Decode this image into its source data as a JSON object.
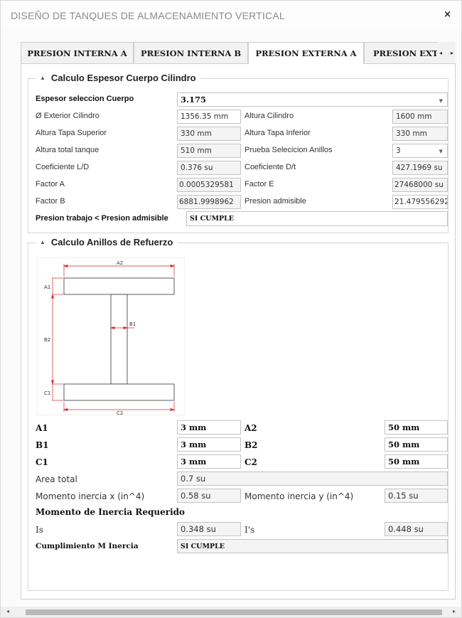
{
  "window": {
    "title": "DISEÑO DE TANQUES DE ALMACENAMIENTO VERTICAL",
    "close_glyph": "×"
  },
  "tabs": [
    {
      "label": "PRESION INTERNA A",
      "active": false
    },
    {
      "label": "PRESION INTERNA B",
      "active": false
    },
    {
      "label": "PRESION EXTERNA A",
      "active": true
    },
    {
      "label": "PRESION EXTERNA B",
      "active": false
    }
  ],
  "tab_nav": {
    "left": "◂",
    "right": "▸"
  },
  "cylinder": {
    "header": "Calculo Espesor Cuerpo Cilindro",
    "espesor_label": "Espesor seleccion Cuerpo",
    "espesor_value": "3.175",
    "exterior_label": "Ø Exterior Cilindro",
    "exterior_value": "1356.35 mm",
    "altura_cil_label": "Altura Cilindro",
    "altura_cil_value": "1600 mm",
    "tapa_sup_label": "Altura Tapa Superior",
    "tapa_sup_value": "330 mm",
    "tapa_inf_label": "Altura Tapa Inferior",
    "tapa_inf_value": "330 mm",
    "total_label": "Altura total tanque",
    "total_value": "510 mm",
    "anillos_label": "Prueba Selecicion Anillos",
    "anillos_value": "3",
    "ld_label": "Coeficiente L/D",
    "ld_value": "0.376 su",
    "dt_label": "Coeficiente D/t",
    "dt_value": "427.1969 su",
    "factor_a_label": "Factor A",
    "factor_a_value": "0.0005329581",
    "factor_e_label": "Factor E",
    "factor_e_value": "27468000 su",
    "factor_b_label": "Factor B",
    "factor_b_value": "6881.9998962",
    "presion_adm_label": "Presion admisible",
    "presion_adm_value": "21.479556292",
    "check_label": "Presion trabajo < Presion admisible",
    "check_value": "SI CUMPLE"
  },
  "rings": {
    "header": "Calculo Anillos de Refuerzo",
    "diagram_labels": {
      "a2": "A2",
      "a1": "A1",
      "b1": "B1",
      "b2": "B2",
      "c1": "C1",
      "c2": "C2"
    },
    "a1_label": "A1",
    "a1_value": "3 mm",
    "a2_label": "A2",
    "a2_value": "50 mm",
    "b1_label": "B1",
    "b1_value": "3 mm",
    "b2_label": "B2",
    "b2_value": "50 mm",
    "c1_label": "C1",
    "c1_value": "3 mm",
    "c2_label": "C2",
    "c2_value": "50 mm",
    "area_label": "Area total",
    "area_value": "0.7 su",
    "mx_label": "Momento inercia x (in^4)",
    "mx_value": "0.58 su",
    "my_label": "Momento inercia y (in^4)",
    "my_value": "0.15 su",
    "req_header": "Momento de Inercia Requerido",
    "is_label": "Is",
    "is_value": "0.348 su",
    "is2_label": "I's",
    "is2_value": "0.448 su",
    "cumpl_label": "Cumplimiento M Inercia",
    "cumpl_value": "SI CUMPLE"
  },
  "scrollbar": {
    "left_arrow": "◂",
    "right_arrow": "▸"
  },
  "colors": {
    "border": "#cfcfcf",
    "field_bg": "#f4f4f4",
    "dim_line": "#d9262a"
  }
}
